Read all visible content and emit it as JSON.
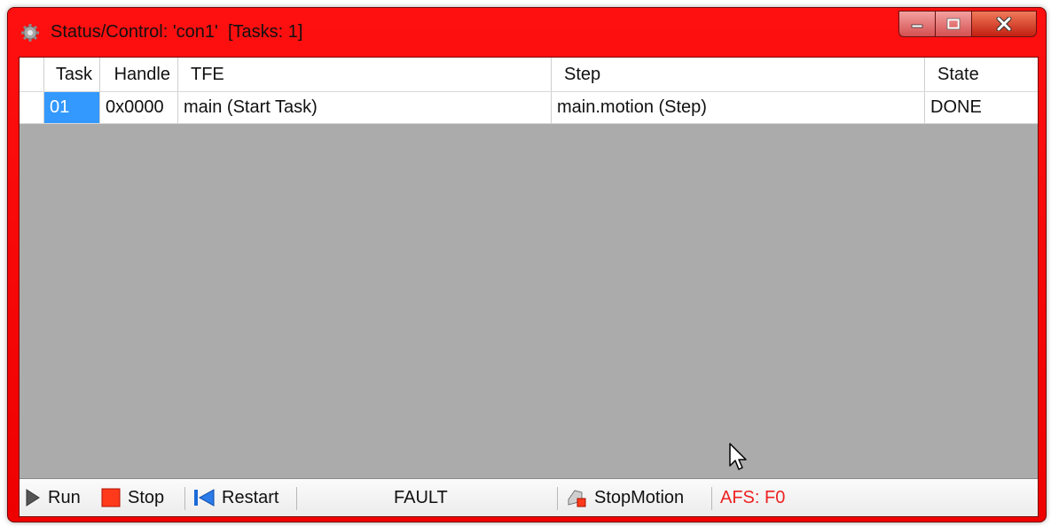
{
  "window": {
    "title": "Status/Control: 'con1'  [Tasks: 1]",
    "title_icon": "gear-icon",
    "frame_color": "#ff0000",
    "caption_buttons": {
      "minimize": "minimize-icon",
      "maximize": "maximize-icon",
      "close": "close-icon"
    }
  },
  "grid": {
    "columns": {
      "task": "Task",
      "handle": "Handle",
      "tfe": "TFE",
      "step": "Step",
      "state": "State"
    },
    "rows": [
      {
        "task": "01",
        "handle": "0x0000",
        "tfe": "main (Start Task)",
        "step": "main.motion (Step)",
        "state": "DONE"
      }
    ],
    "selected_color": "#3399ff",
    "empty_area_color": "#ababab"
  },
  "toolbar": {
    "run_label": "Run",
    "stop_label": "Stop",
    "restart_label": "Restart",
    "fault_label": "FAULT",
    "stopmotion_label": "StopMotion",
    "afs_label": "AFS: F0",
    "afs_color": "#ee2222"
  }
}
